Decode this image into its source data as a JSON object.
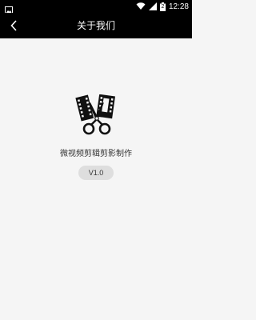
{
  "status_bar": {
    "time": "12:28",
    "battery_level": "2",
    "icons": [
      "image-icon",
      "wifi-icon",
      "signal-icon",
      "battery-icon"
    ]
  },
  "toolbar": {
    "title": "关于我们",
    "back_icon": "chevron-left-icon"
  },
  "about": {
    "logo_icon": "scissors-film-icon",
    "app_name": "微视频剪辑剪影制作",
    "version": "V1.0"
  },
  "colors": {
    "toolbar_bg": "#000000",
    "page_bg": "#f5f5f5",
    "badge_bg": "#dedede",
    "text": "#333333"
  }
}
